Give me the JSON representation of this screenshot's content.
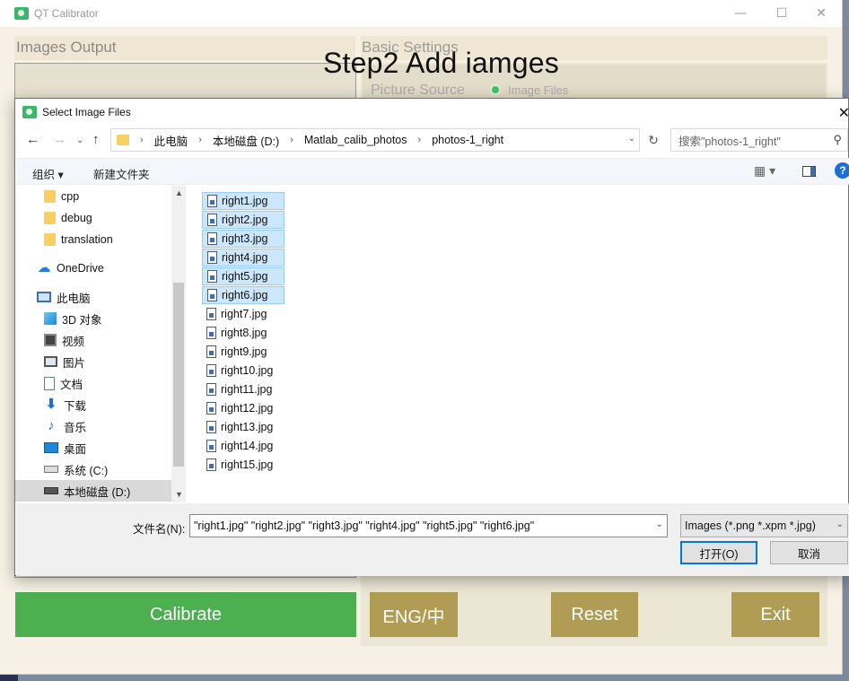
{
  "app": {
    "title": "QT Calibrator",
    "window_controls": {
      "minimize": "—",
      "maximize": "☐",
      "close": "✕"
    },
    "banner": "Step2  Add iamges",
    "images_output_title": "Images Output",
    "basic_settings_title": "Basic Settings",
    "picture_source_label": "Picture Source",
    "picture_source_option": "Image Files",
    "buttons": {
      "calibrate": "Calibrate",
      "language": "ENG/中",
      "reset": "Reset",
      "exit": "Exit"
    },
    "colors": {
      "calibrate": "#4caf50",
      "olive": "#b09c52",
      "background": "#f6f1e4"
    }
  },
  "dialog": {
    "title": "Select Image Files",
    "close": "✕",
    "breadcrumb": [
      "此电脑",
      "本地磁盘 (D:)",
      "Matlab_calib_photos",
      "photos-1_right"
    ],
    "search_placeholder": "搜索\"photos-1_right\"",
    "toolbar": {
      "organize": "组织 ▾",
      "new_folder": "新建文件夹",
      "view": "▦ ▾",
      "help": "?"
    },
    "nav_items": [
      {
        "label": "cpp",
        "icon": "folder-icon"
      },
      {
        "label": "debug",
        "icon": "folder-icon"
      },
      {
        "label": "translation",
        "icon": "folder-icon"
      },
      {
        "label": "OneDrive",
        "icon": "cloud-icon"
      },
      {
        "label": "此电脑",
        "icon": "computer-icon"
      },
      {
        "label": "3D 对象",
        "icon": "cube-icon"
      },
      {
        "label": "视频",
        "icon": "video-icon"
      },
      {
        "label": "图片",
        "icon": "picture-icon"
      },
      {
        "label": "文档",
        "icon": "document-icon"
      },
      {
        "label": "下载",
        "icon": "download-icon"
      },
      {
        "label": "音乐",
        "icon": "music-icon"
      },
      {
        "label": "桌面",
        "icon": "desktop-icon"
      },
      {
        "label": "系统 (C:)",
        "icon": "drive-icon"
      },
      {
        "label": "本地磁盘 (D:)",
        "icon": "drive-icon",
        "selected": true
      }
    ],
    "files": [
      {
        "name": "right1.jpg",
        "selected": true
      },
      {
        "name": "right2.jpg",
        "selected": true
      },
      {
        "name": "right3.jpg",
        "selected": true
      },
      {
        "name": "right4.jpg",
        "selected": true
      },
      {
        "name": "right5.jpg",
        "selected": true
      },
      {
        "name": "right6.jpg",
        "selected": true
      },
      {
        "name": "right7.jpg",
        "selected": false
      },
      {
        "name": "right8.jpg",
        "selected": false
      },
      {
        "name": "right9.jpg",
        "selected": false
      },
      {
        "name": "right10.jpg",
        "selected": false
      },
      {
        "name": "right11.jpg",
        "selected": false
      },
      {
        "name": "right12.jpg",
        "selected": false
      },
      {
        "name": "right13.jpg",
        "selected": false
      },
      {
        "name": "right14.jpg",
        "selected": false
      },
      {
        "name": "right15.jpg",
        "selected": false
      }
    ],
    "filename_label": "文件名(N):",
    "filename_value": "\"right1.jpg\" \"right2.jpg\" \"right3.jpg\" \"right4.jpg\" \"right5.jpg\" \"right6.jpg\"",
    "filter_value": "Images (*.png *.xpm *.jpg)",
    "open_label": "打开(O)",
    "cancel_label": "取消"
  }
}
